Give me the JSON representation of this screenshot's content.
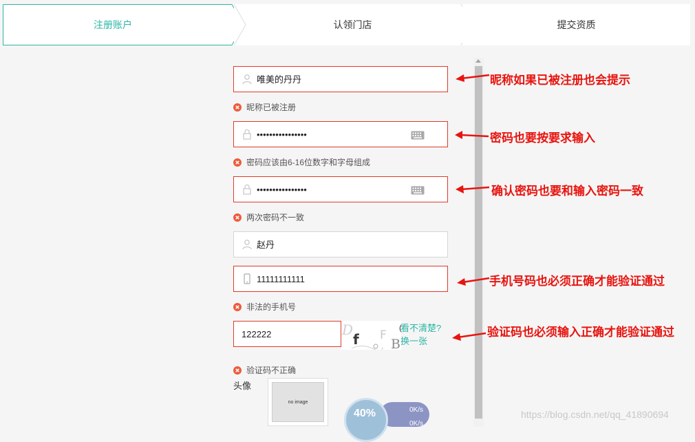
{
  "stepper": {
    "steps": [
      "注册账户",
      "认领门店",
      "提交资质"
    ]
  },
  "form": {
    "nickname_value": "唯美的丹丹",
    "nickname_error": "昵称已被注册",
    "password_value": "••••••••••••••••",
    "password_error": "密码应该由6-16位数字和字母组成",
    "confirm_value": "••••••••••••••••",
    "confirm_error": "两次密码不一致",
    "realname_value": "赵丹",
    "phone_value": "11111111111",
    "phone_error": "非法的手机号",
    "captcha_value": "122222",
    "captcha_paren": "(",
    "captcha_link_line1": "看不清楚?",
    "captcha_link_line2": "换一张",
    "captcha_error": "验证码不正确",
    "avatar_label": "头像",
    "avatar_placeholder": "no image"
  },
  "speed_widget": {
    "percent": "40%",
    "up": "0K/s",
    "down": "0K/s"
  },
  "annotations": {
    "nickname": "昵称如果已被注册也会提示",
    "password": "密码也要按要求输入",
    "confirm": "确认密码也要和输入密码一致",
    "phone": "手机号码也必须正确才能验证通过",
    "captcha": "验证码也必须输入正确才能验证通过"
  },
  "watermark": "https://blog.csdn.net/qq_41890694",
  "colors": {
    "accent": "#2bb6a3",
    "error_border": "#e03a2a",
    "annotation": "#e8140f"
  }
}
